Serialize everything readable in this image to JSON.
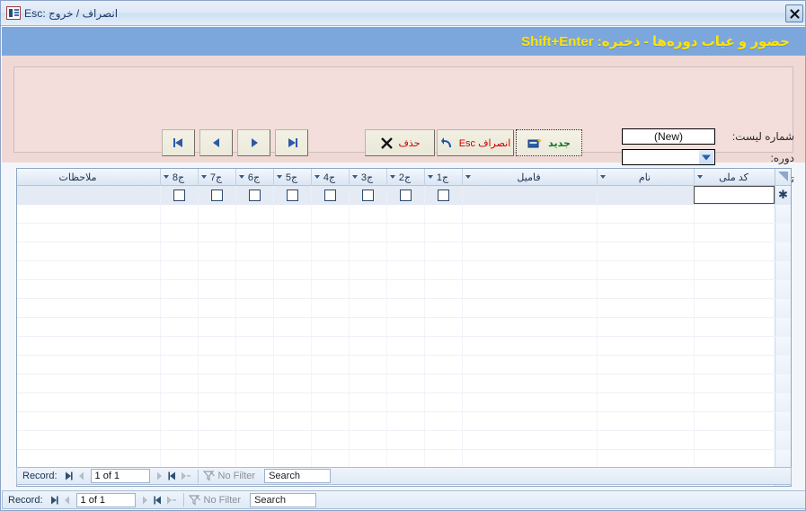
{
  "window": {
    "title": "انصراف / خروج  :Esc",
    "icon": "access-form-icon",
    "close_label": "✕"
  },
  "header": {
    "title": "حضور و غیاب دوره‌ها - ذخیره: Shift+Enter",
    "title_color": "#ffe400",
    "background_color": "#7ba7dd"
  },
  "panel": {
    "background_color": "#f0d9d5",
    "nav": {
      "first_label": "⏮",
      "prev_label": "◀",
      "next_label": "▶",
      "last_label": "⏭"
    },
    "buttons": {
      "delete_label": "حذف",
      "cancel_label": "انصراف Esc",
      "new_label": "جدید"
    },
    "fields": {
      "list_no_label": "شماره لیست:",
      "list_no_value": "(New)",
      "dore_label": "دوره:",
      "dore_value": "",
      "desc_label": "توضیحات:",
      "desc_value": ""
    }
  },
  "datasheet": {
    "columns": [
      {
        "name": "کد ملی"
      },
      {
        "name": "نام"
      },
      {
        "name": "فامیل"
      },
      {
        "name": "ج1"
      },
      {
        "name": "ج2"
      },
      {
        "name": "ج3"
      },
      {
        "name": "ج4"
      },
      {
        "name": "ج5"
      },
      {
        "name": "ج6"
      },
      {
        "name": "ج7"
      },
      {
        "name": "ج8"
      },
      {
        "name": "ملاحظات"
      }
    ],
    "new_record_marker": "✱",
    "rows": []
  },
  "record_nav_sub": {
    "record_label": "Record:",
    "position": "1 of 1",
    "filter_label": "No Filter",
    "search_value": "Search"
  },
  "record_nav_main": {
    "record_label": "Record:",
    "position": "1 of 1",
    "filter_label": "No Filter",
    "search_value": "Search"
  }
}
